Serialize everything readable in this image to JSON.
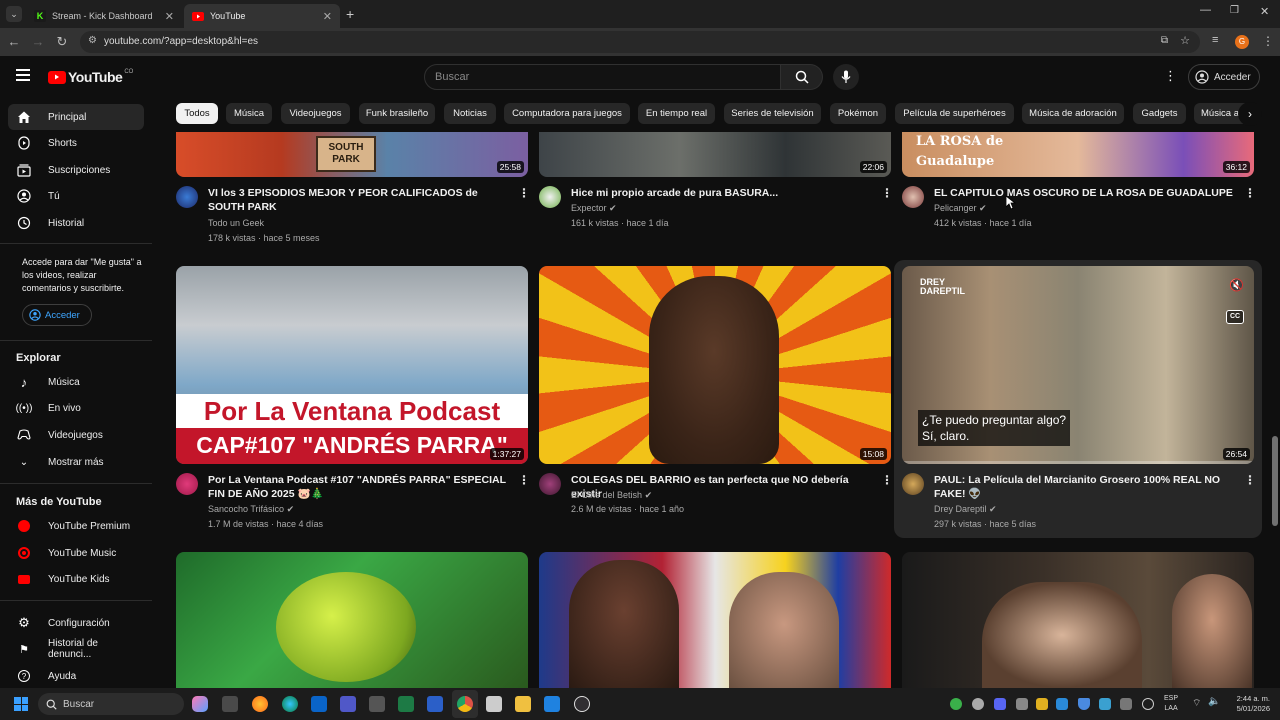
{
  "browser": {
    "tabs": [
      {
        "title": "Stream - Kick Dashboard"
      },
      {
        "title": "YouTube"
      }
    ],
    "url": "youtube.com/?app=desktop&hl=es"
  },
  "header": {
    "logo": "YouTube",
    "logo_sup": "CO",
    "search_placeholder": "Buscar",
    "signin": "Acceder"
  },
  "sidebar": {
    "main": [
      {
        "label": "Principal"
      },
      {
        "label": "Shorts"
      },
      {
        "label": "Suscripciones"
      },
      {
        "label": "Tú"
      },
      {
        "label": "Historial"
      }
    ],
    "signin_prompt": "Accede para dar \"Me gusta\" a los videos, realizar comentarios y suscribirte.",
    "signin_button": "Acceder",
    "explore_title": "Explorar",
    "explore": [
      {
        "label": "Música"
      },
      {
        "label": "En vivo"
      },
      {
        "label": "Videojuegos"
      },
      {
        "label": "Mostrar más"
      }
    ],
    "more_title": "Más de YouTube",
    "more": [
      {
        "label": "YouTube Premium"
      },
      {
        "label": "YouTube Music"
      },
      {
        "label": "YouTube Kids"
      }
    ],
    "bottom": [
      {
        "label": "Configuración"
      },
      {
        "label": "Historial de denunci..."
      },
      {
        "label": "Ayuda"
      }
    ]
  },
  "chips": [
    "Todos",
    "Música",
    "Videojuegos",
    "Funk brasileño",
    "Noticias",
    "Computadora para juegos",
    "En tiempo real",
    "Series de televisión",
    "Pokémon",
    "Película de superhéroes",
    "Música de adoración",
    "Gadgets",
    "Música a"
  ],
  "videos": [
    {
      "title": "VI los 3 EPISODIOS MEJOR Y PEOR CALIFICADOS de SOUTH PARK",
      "channel": "Todo un Geek",
      "meta": "178 k vistas · hace 5 meses",
      "duration": "25:58",
      "thumb_text": "SOUTH PARK"
    },
    {
      "title": "Hice mi propio arcade de pura BASURA...",
      "channel": "Expector",
      "meta": "161 k vistas · hace 1 día",
      "duration": "22:06",
      "thumb_text": ""
    },
    {
      "title": "EL CAPITULO MAS OSCURO DE LA ROSA DE GUADALUPE",
      "channel": "Pelicanger",
      "meta": "412 k vistas · hace 1 día",
      "duration": "36:12",
      "thumb_text": "LA ROSA de Guadalupe"
    },
    {
      "title": "Por La Ventana Podcast #107 \"ANDRÉS PARRA\" ESPECIAL FIN DE AÑO 2025 🐷🎄",
      "channel": "Sancocho Trifásico",
      "meta": "1.7 M de vistas · hace 4 días",
      "duration": "1:37:27",
      "thumb_text": "Por La Ventana Podcast",
      "thumb_text2": "CAP#107 \"ANDRÉS PARRA\""
    },
    {
      "title": "COLEGAS DEL BARRIO es tan perfecta que NO debería existir",
      "channel": "El Cine del Betish",
      "meta": "2.6 M de vistas · hace 1 año",
      "duration": "15:08",
      "thumb_text": ""
    },
    {
      "title": "PAUL: La Película del Marcianito Grosero 100% REAL NO FAKE! 👽",
      "channel": "Drey Dareptil",
      "meta": "297 k vistas · hace 5 días",
      "duration": "26:54",
      "thumb_text": "DREY DAREPTIL",
      "subtitle1": "¿Te puedo preguntar algo?",
      "subtitle2": "Sí, claro."
    }
  ],
  "taskbar": {
    "search": "Buscar",
    "lang1": "ESP",
    "lang2": "LAA",
    "time": "2:44 a. m.",
    "date": "5/01/2026"
  },
  "colors": {
    "bg": "#0f0f0f",
    "accent": "#ff0000"
  }
}
